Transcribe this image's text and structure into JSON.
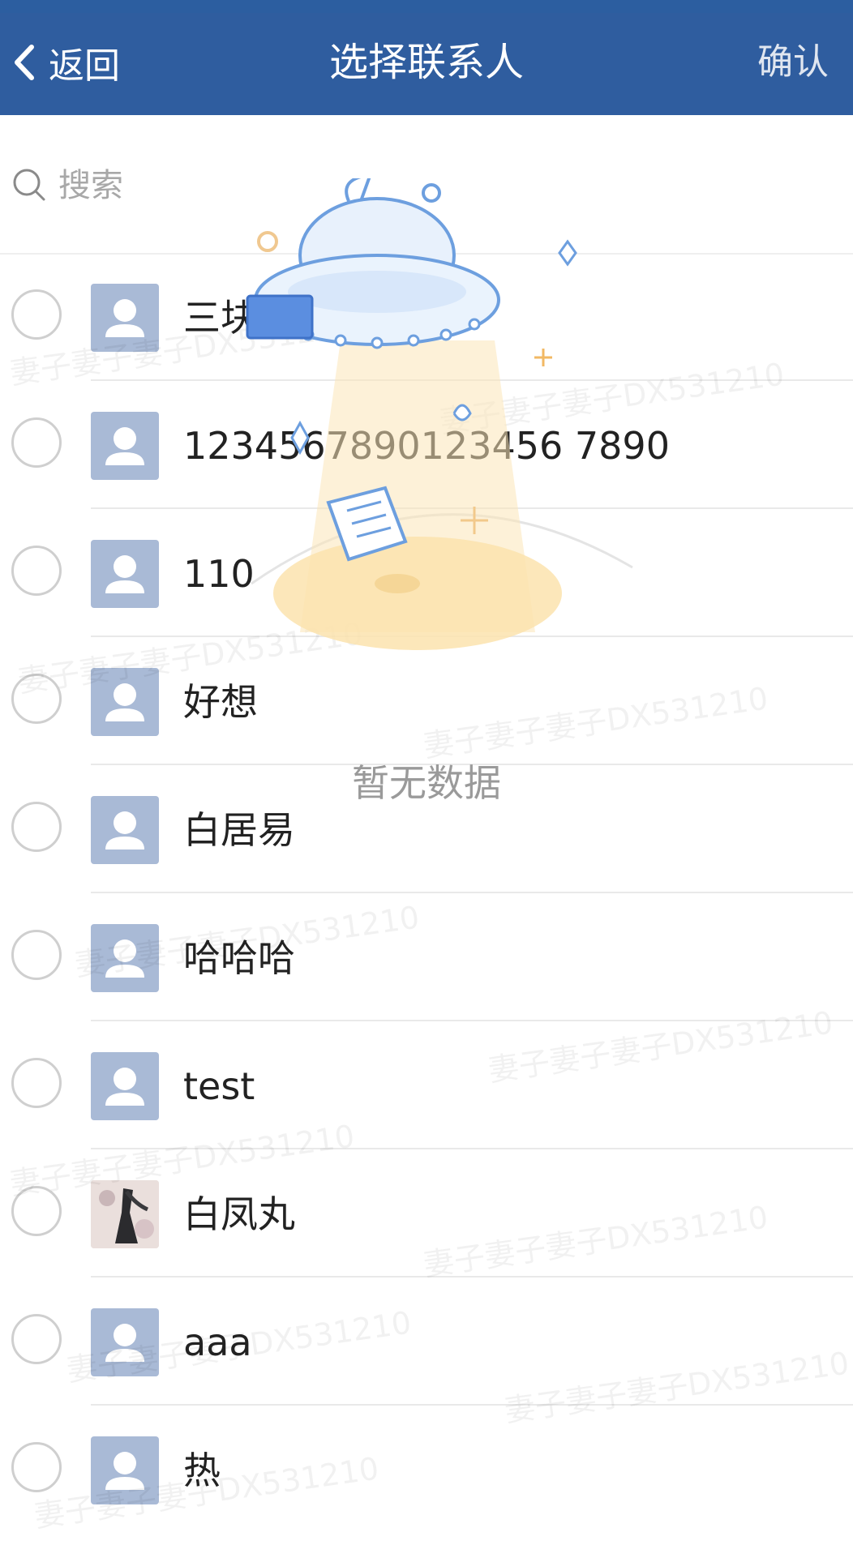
{
  "nav": {
    "back_label": "返回",
    "title": "选择联系人",
    "confirm_label": "确认"
  },
  "search": {
    "placeholder": "搜索"
  },
  "contacts": [
    {
      "name": "三块",
      "avatar": "default-avatar-icon"
    },
    {
      "name": "1234567890123456 7890",
      "avatar": "default-avatar-icon"
    },
    {
      "name": "110",
      "avatar": "default-avatar-icon"
    },
    {
      "name": "好想",
      "avatar": "default-avatar-icon"
    },
    {
      "name": "白居易",
      "avatar": "default-avatar-icon"
    },
    {
      "name": "哈哈哈",
      "avatar": "default-avatar-icon"
    },
    {
      "name": "test",
      "avatar": "default-avatar-icon"
    },
    {
      "name": "白凤丸",
      "avatar": "photo-avatar"
    },
    {
      "name": "aaa",
      "avatar": "default-avatar-icon"
    },
    {
      "name": "热",
      "avatar": "default-avatar-icon"
    }
  ],
  "empty_state": {
    "text": "暂无数据",
    "icon": "ufo-illustration"
  },
  "watermark": {
    "text": "妻子妻子妻子DX531210"
  },
  "colors": {
    "nav_bg": "#2f5d9f",
    "avatar_bg": "#a9bad6",
    "radio_border": "#cfcfcf"
  }
}
